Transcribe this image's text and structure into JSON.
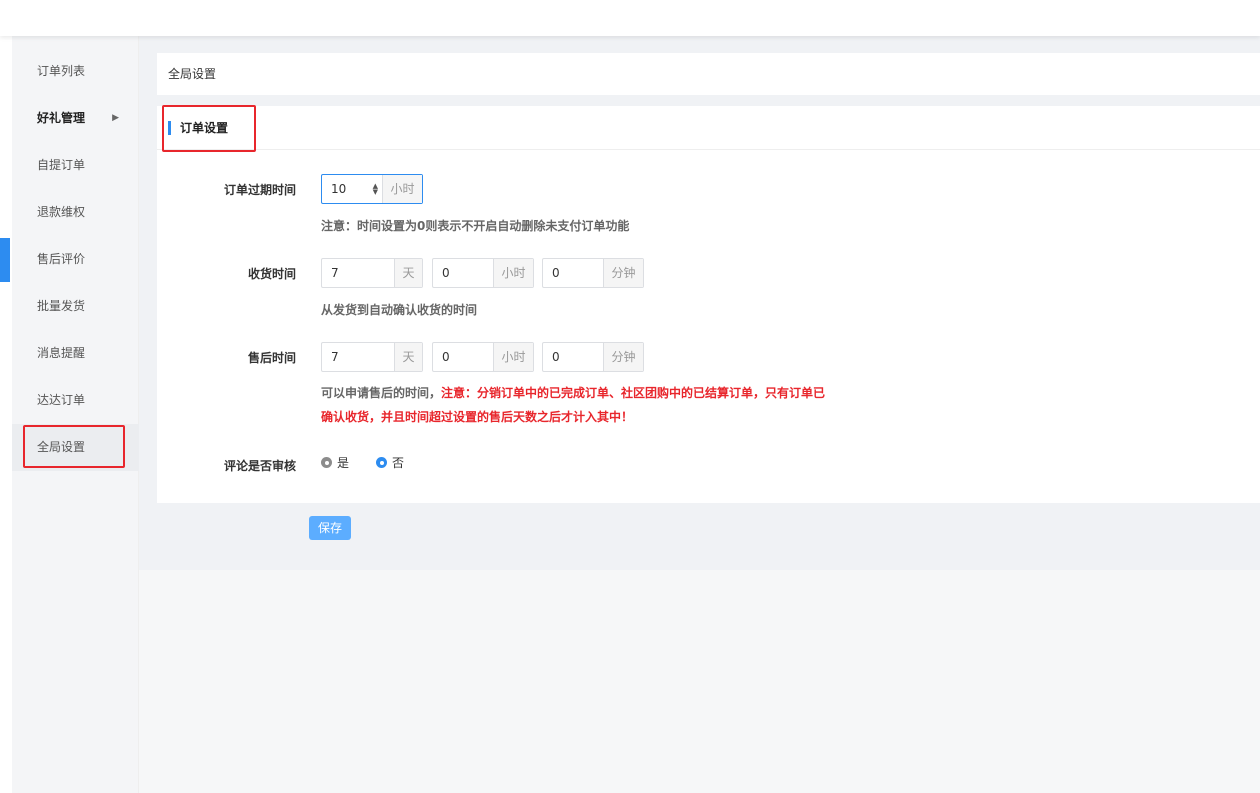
{
  "sidebar": {
    "items": [
      {
        "label": "订单列表"
      },
      {
        "label": "好礼管理"
      },
      {
        "label": "自提订单"
      },
      {
        "label": "退款维权"
      },
      {
        "label": "售后评价"
      },
      {
        "label": "批量发货"
      },
      {
        "label": "消息提醒"
      },
      {
        "label": "达达订单"
      },
      {
        "label": "全局设置"
      }
    ]
  },
  "breadcrumb": {
    "title": "全局设置"
  },
  "card": {
    "title": "订单设置"
  },
  "form": {
    "expire": {
      "label": "订单过期时间",
      "value": "10",
      "unit": "小时",
      "hint": "注意：时间设置为0则表示不开启自动删除未支付订单功能"
    },
    "receive": {
      "label": "收货时间",
      "days": "7",
      "days_unit": "天",
      "hours": "0",
      "hours_unit": "小时",
      "minutes": "0",
      "minutes_unit": "分钟",
      "hint": "从发货到自动确认收货的时间"
    },
    "aftersale": {
      "label": "售后时间",
      "days": "7",
      "days_unit": "天",
      "hours": "0",
      "hours_unit": "小时",
      "minutes": "0",
      "minutes_unit": "分钟",
      "hint_prefix": "可以申请售后的时间，",
      "hint_red_1": "注意：分销订单中的已完成订单、社区团购中的已结算订单，只有订单已",
      "hint_red_2": "确认收货，并且时间超过设置的售后天数之后才计入其中！"
    },
    "review": {
      "label": "评论是否审核",
      "option_yes": "是",
      "option_no": "否",
      "selected": "否"
    }
  },
  "actions": {
    "save_label": "保存"
  },
  "colors": {
    "accent": "#2d8cf0",
    "highlight": "#e8262c",
    "button": "#5cadff"
  }
}
